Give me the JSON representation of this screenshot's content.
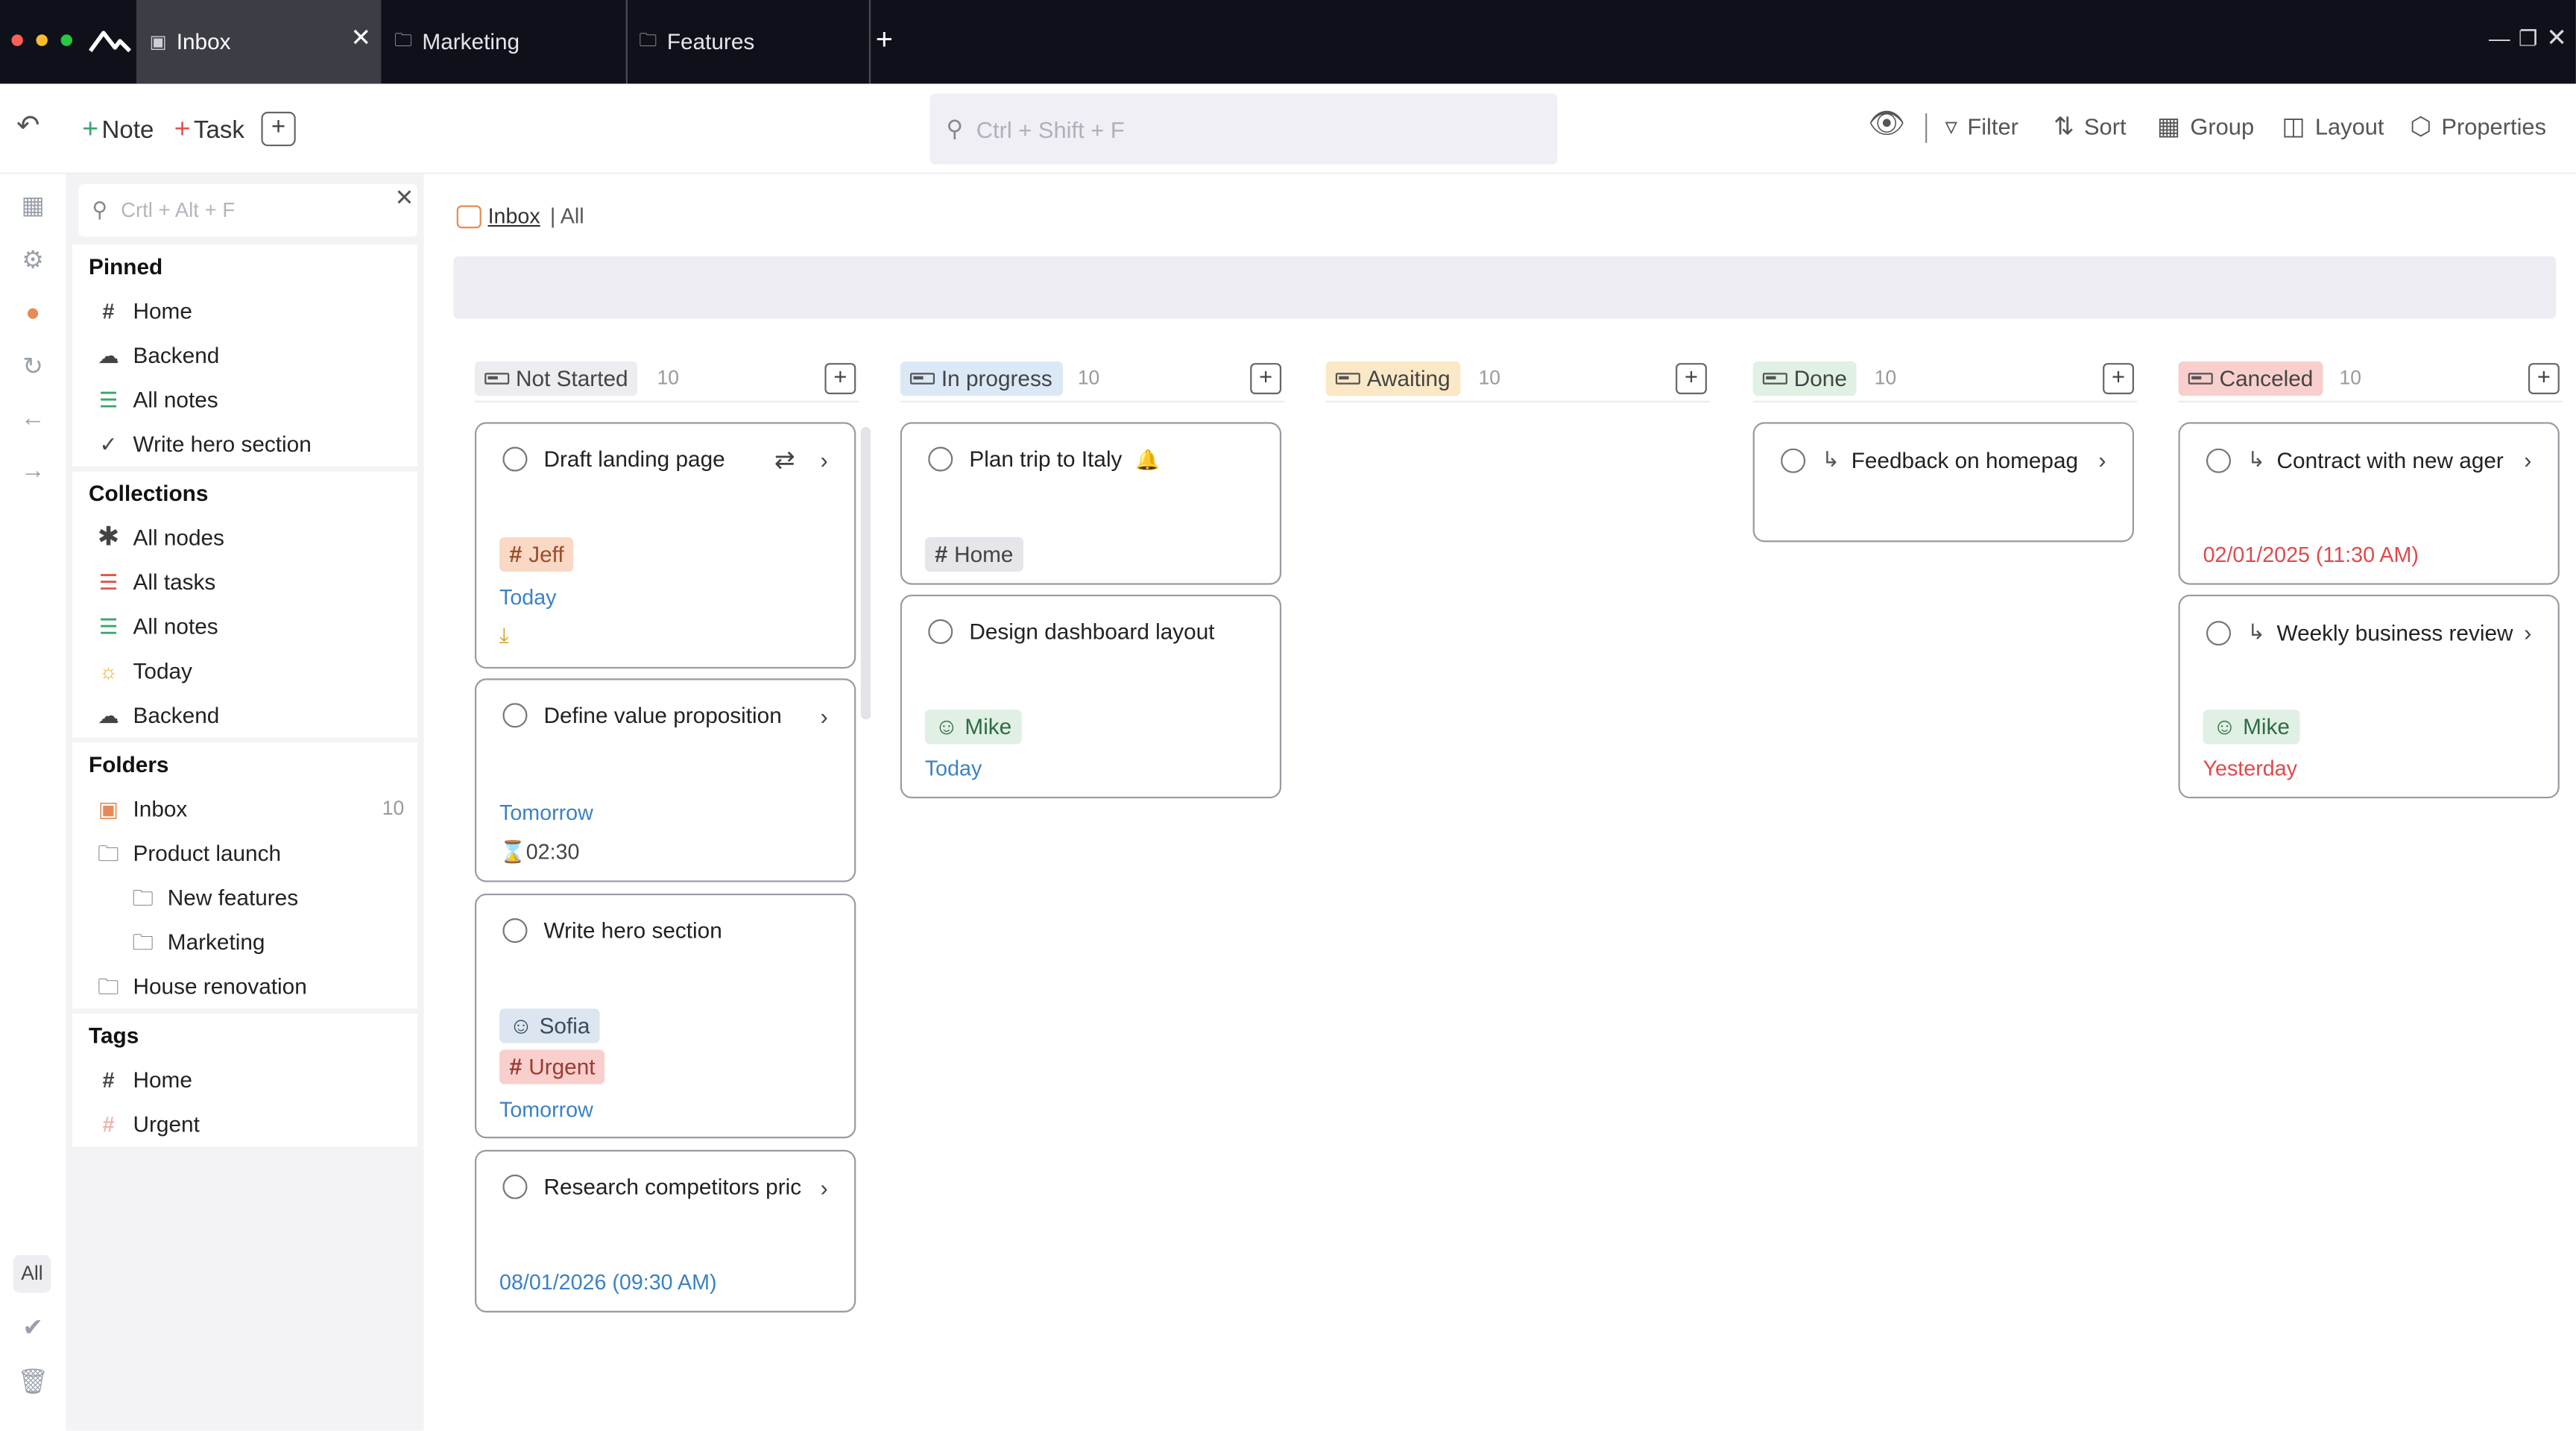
{
  "colors": {
    "titlebar": "#0f111a",
    "accent_orange": "#e88a55",
    "date_blue": "#3b82c4",
    "date_red": "#e0494b",
    "not_started_chip": "#ececf1",
    "in_progress_chip": "#dbe9f7",
    "awaiting_chip": "#fbe8c6",
    "done_chip": "#e0f0e4",
    "canceled_chip": "#f8cfcc"
  },
  "titlebar": {
    "tabs": [
      {
        "label": "Inbox",
        "icon": "inbox-icon",
        "active": true
      },
      {
        "label": "Marketing",
        "icon": "folder-icon",
        "active": false
      },
      {
        "label": "Features",
        "icon": "folder-icon",
        "active": false
      }
    ]
  },
  "toolbar": {
    "note_label": "Note",
    "task_label": "Task",
    "search_placeholder": "Ctrl + Shift + F",
    "filter_label": "Filter",
    "sort_label": "Sort",
    "group_label": "Group",
    "layout_label": "Layout",
    "properties_label": "Properties"
  },
  "sidebar": {
    "search_placeholder": "Crtl + Alt + F",
    "pinned": {
      "title": "Pinned",
      "items": [
        {
          "label": "Home",
          "icon": "hash-icon"
        },
        {
          "label": "Backend",
          "icon": "cloud-icon"
        },
        {
          "label": "All notes",
          "icon": "notes-icon"
        },
        {
          "label": "Write hero section",
          "icon": "check-circle-icon"
        }
      ]
    },
    "collections": {
      "title": "Collections",
      "items": [
        {
          "label": "All nodes",
          "icon": "asterisk-icon"
        },
        {
          "label": "All tasks",
          "icon": "tasks-icon"
        },
        {
          "label": "All notes",
          "icon": "notes-icon"
        },
        {
          "label": "Today",
          "icon": "sun-icon"
        },
        {
          "label": "Backend",
          "icon": "cloud-icon"
        }
      ]
    },
    "folders": {
      "title": "Folders",
      "items": [
        {
          "label": "Inbox",
          "icon": "inbox-icon",
          "count": "10"
        },
        {
          "label": "Product launch",
          "icon": "folder-icon"
        },
        {
          "label": "New features",
          "icon": "folder-icon"
        },
        {
          "label": "Marketing",
          "icon": "folder-icon"
        },
        {
          "label": "House renovation",
          "icon": "folder-icon"
        }
      ]
    },
    "tags": {
      "title": "Tags",
      "items": [
        {
          "label": "Home",
          "icon": "hash-icon"
        },
        {
          "label": "Urgent",
          "icon": "hash-icon"
        }
      ]
    }
  },
  "rail": {
    "all_label": "All"
  },
  "main": {
    "breadcrumb": {
      "folder": "Inbox",
      "view": "| All"
    },
    "columns": [
      {
        "status": "Not Started",
        "count": "10",
        "cards": [
          {
            "title": "Draft landing page",
            "tag": "Jeff",
            "date": "Today"
          },
          {
            "title": "Define value proposition",
            "date": "Tomorrow",
            "timer": "02:30"
          },
          {
            "title": "Write hero section",
            "person": "Sofia",
            "tag": "Urgent",
            "date": "Tomorrow"
          },
          {
            "title": "Research competitors pric",
            "date": "08/01/2026 (09:30 AM)"
          }
        ]
      },
      {
        "status": "In progress",
        "count": "10",
        "cards": [
          {
            "title": "Plan trip to Italy",
            "tag": "Home"
          },
          {
            "title": "Design dashboard layout",
            "person": "Mike",
            "date": "Today"
          }
        ]
      },
      {
        "status": "Awaiting",
        "count": "10",
        "cards": []
      },
      {
        "status": "Done",
        "count": "10",
        "cards": [
          {
            "title": "Feedback on homepag"
          }
        ]
      },
      {
        "status": "Canceled",
        "count": "10",
        "cards": [
          {
            "title": "Contract with new ager",
            "date": "02/01/2025 (11:30 AM)"
          },
          {
            "title": "Weekly business review",
            "person": "Mike",
            "date": "Yesterday"
          }
        ]
      }
    ]
  }
}
